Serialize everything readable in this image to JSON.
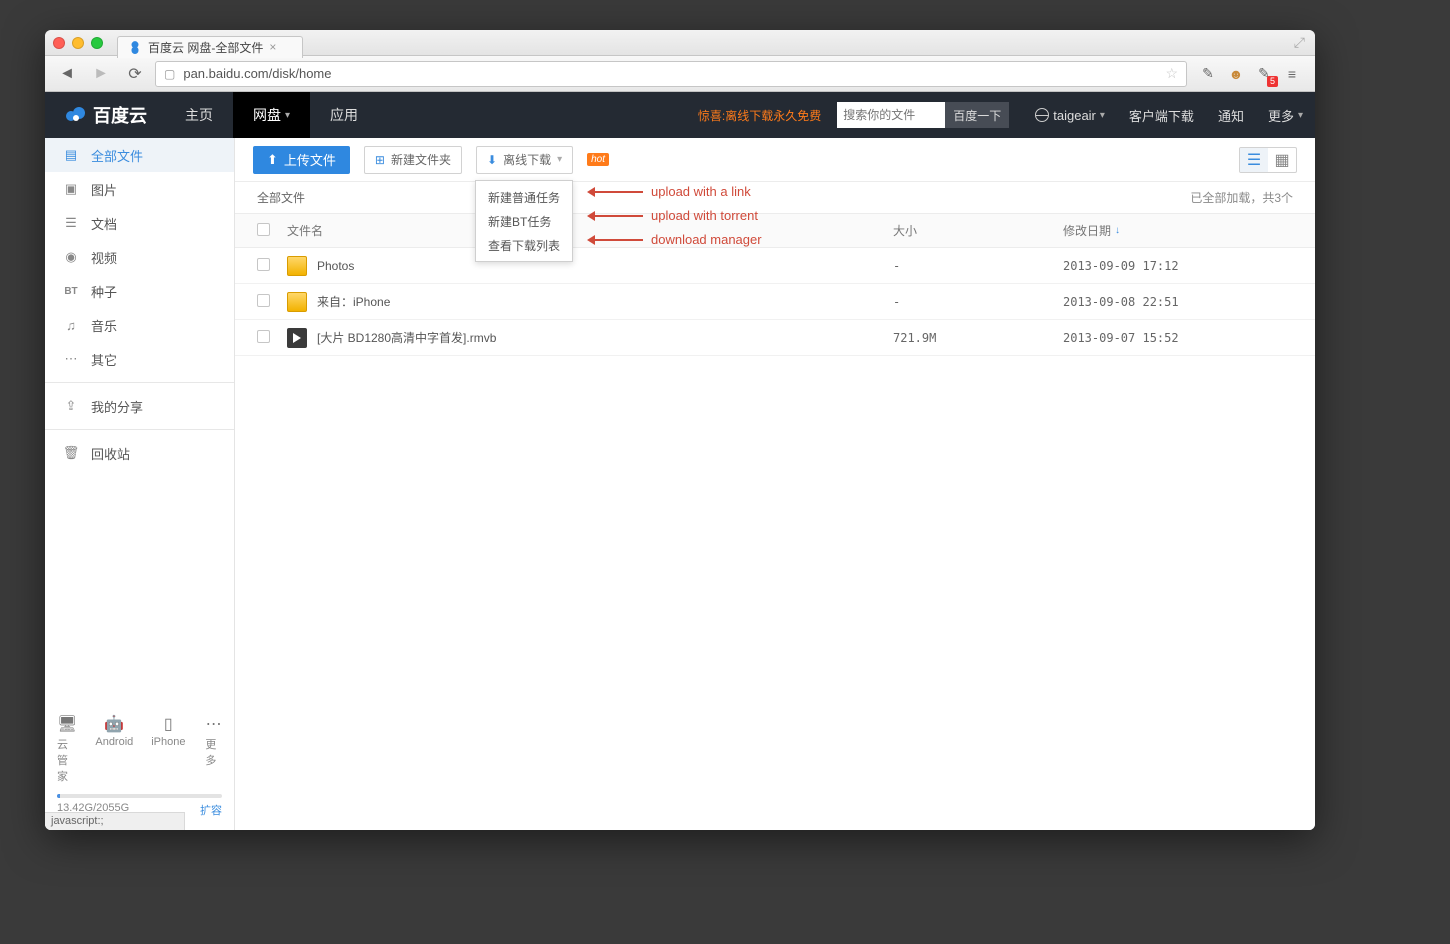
{
  "window": {
    "tab_title": "百度云 网盘-全部文件",
    "url": "pan.baidu.com/disk/home",
    "status_text": "javascript:;"
  },
  "ext_badge": "5",
  "header": {
    "logo": "百度云",
    "nav": [
      "主页",
      "网盘",
      "应用"
    ],
    "active_nav_index": 1,
    "promo": "惊喜:离线下载永久免费",
    "search_placeholder": "搜索你的文件",
    "search_button": "百度一下",
    "username": "taigeair",
    "links": [
      "客户端下载",
      "通知",
      "更多"
    ]
  },
  "sidebar": {
    "items": [
      {
        "label": "全部文件",
        "icon": "file-icon"
      },
      {
        "label": "图片",
        "icon": "image-icon"
      },
      {
        "label": "文档",
        "icon": "doc-icon"
      },
      {
        "label": "视频",
        "icon": "video-icon"
      },
      {
        "label": "种子",
        "icon": "bt-icon"
      },
      {
        "label": "音乐",
        "icon": "music-icon"
      },
      {
        "label": "其它",
        "icon": "dots-icon"
      }
    ],
    "share_label": "我的分享",
    "trash_label": "回收站",
    "devices": [
      "云管家",
      "Android",
      "iPhone",
      "更多"
    ],
    "quota_used": "13.42G",
    "quota_total": "2055G",
    "quota_link": "扩容"
  },
  "toolbar": {
    "upload_label": "上传文件",
    "newfolder_label": "新建文件夹",
    "offline_label": "离线下载",
    "hot_badge": "hot"
  },
  "dropdown": {
    "items": [
      "新建普通任务",
      "新建BT任务",
      "查看下载列表"
    ]
  },
  "annotations": [
    "upload with a link",
    "upload with torrent",
    "download manager"
  ],
  "breadcrumb": {
    "path": "全部文件",
    "loaded": "已全部加载，共3个"
  },
  "table": {
    "columns": {
      "name": "文件名",
      "size": "大小",
      "date": "修改日期"
    },
    "rows": [
      {
        "name": "Photos",
        "type": "folder",
        "size": "-",
        "date": "2013-09-09 17:12"
      },
      {
        "name": "来自：iPhone",
        "type": "folder",
        "size": "-",
        "date": "2013-09-08 22:51"
      },
      {
        "name": "[大片 BD1280高清中字首发].rmvb",
        "type": "video",
        "size": "721.9M",
        "date": "2013-09-07 15:52"
      }
    ]
  }
}
